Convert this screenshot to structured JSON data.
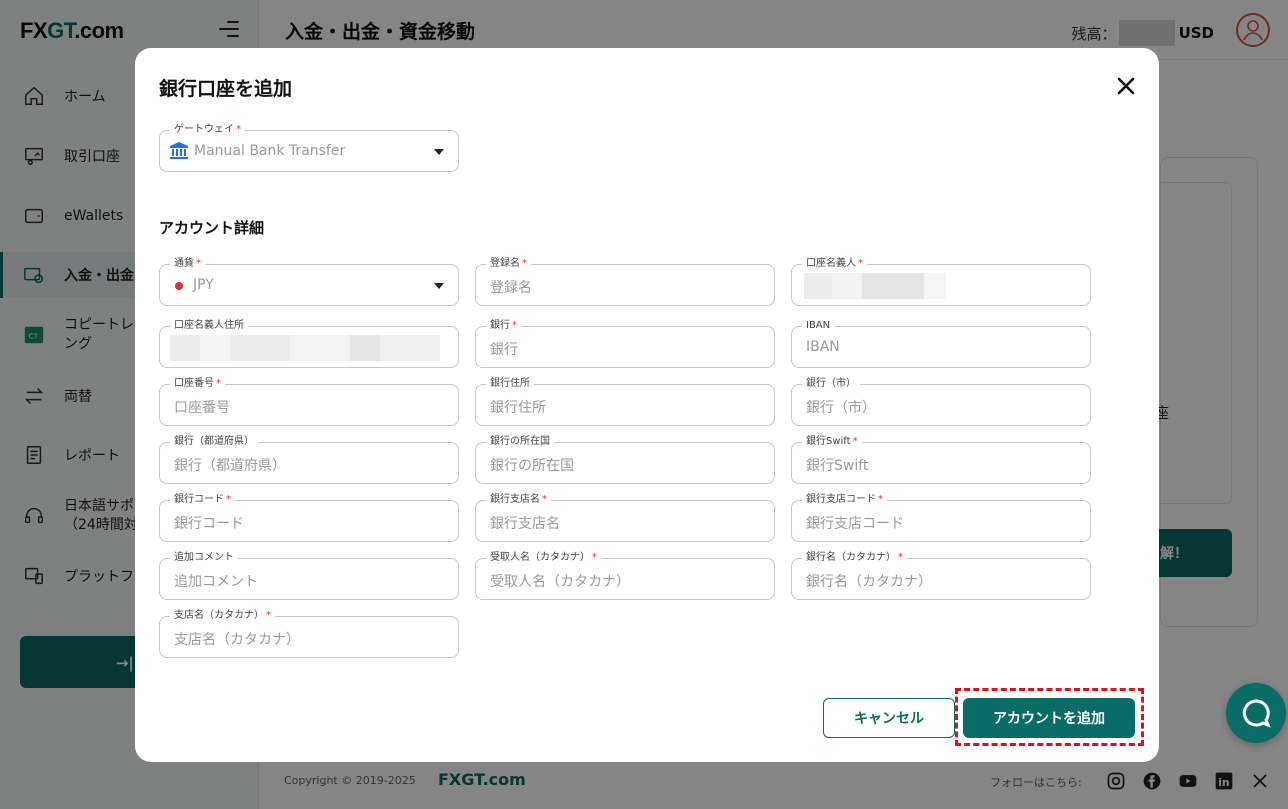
{
  "brand": {
    "logo_text_a": "FX",
    "logo_text_b": "GT",
    "logo_text_c": ".com"
  },
  "sidebar": {
    "items": [
      {
        "label": "ホーム",
        "icon": "home-icon"
      },
      {
        "label": "取引口座",
        "icon": "trading-account-icon"
      },
      {
        "label": "eWallets",
        "icon": "wallet-icon"
      },
      {
        "label": "入金・出金",
        "icon": "deposit-withdraw-icon"
      },
      {
        "label": "コピートレ",
        "label2": "ング",
        "icon": "copy-trade-icon"
      },
      {
        "label": "両替",
        "icon": "exchange-icon"
      },
      {
        "label": "レポート",
        "icon": "report-icon"
      },
      {
        "label": "日本語サポ",
        "label2": "（24時間対",
        "icon": "support-icon"
      },
      {
        "label": "プラットフ",
        "icon": "platform-icon"
      }
    ],
    "cta_label": "→| 入"
  },
  "header": {
    "title": "入金・出金・資金移動",
    "balance_label": "残高：",
    "balance_currency": "USD"
  },
  "background": {
    "partial_text": "座",
    "partial_button": "解！"
  },
  "footer": {
    "copyright": "Copyright © 2019-2025",
    "brand": "FXGT.com",
    "follow": "フォローはこちら:"
  },
  "modal": {
    "title": "銀行口座を追加",
    "gateway": {
      "label": "ゲートウェイ",
      "value": "Manual Bank Transfer"
    },
    "section_title": "アカウント詳細",
    "fields": [
      {
        "label": "通貨",
        "required": true,
        "value": "JPY"
      },
      {
        "label": "登録名",
        "required": true,
        "placeholder": "登録名"
      },
      {
        "label": "口座名義人",
        "required": true,
        "placeholder": ""
      },
      {
        "label": "口座名義人住所",
        "required": false,
        "placeholder": ""
      },
      {
        "label": "銀行",
        "required": true,
        "placeholder": "銀行"
      },
      {
        "label": "IBAN",
        "required": false,
        "placeholder": "IBAN"
      },
      {
        "label": "口座番号",
        "required": true,
        "placeholder": "口座番号"
      },
      {
        "label": "銀行住所",
        "required": false,
        "placeholder": "銀行住所"
      },
      {
        "label": "銀行（市）",
        "required": false,
        "placeholder": "銀行（市）"
      },
      {
        "label": "銀行（都道府県）",
        "required": false,
        "placeholder": "銀行（都道府県）"
      },
      {
        "label": "銀行の所在国",
        "required": false,
        "placeholder": "銀行の所在国"
      },
      {
        "label": "銀行Swift",
        "required": true,
        "placeholder": "銀行Swift"
      },
      {
        "label": "銀行コード",
        "required": true,
        "placeholder": "銀行コード"
      },
      {
        "label": "銀行支店名",
        "required": true,
        "placeholder": "銀行支店名"
      },
      {
        "label": "銀行支店コード",
        "required": true,
        "placeholder": "銀行支店コード"
      },
      {
        "label": "追加コメント",
        "required": false,
        "placeholder": "追加コメント"
      },
      {
        "label": "受取人名（カタカナ）",
        "required": true,
        "placeholder": "受取人名（カタカナ）"
      },
      {
        "label": "銀行名（カタカナ）",
        "required": true,
        "placeholder": "銀行名（カタカナ）"
      },
      {
        "label": "支店名（カタカナ）",
        "required": true,
        "placeholder": "支店名（カタカナ）"
      }
    ],
    "cancel_label": "キャンセル",
    "submit_label": "アカウントを追加"
  },
  "colors": {
    "accent": "#0a6c66",
    "required": "#e0303a",
    "highlight": "#e0101a"
  }
}
